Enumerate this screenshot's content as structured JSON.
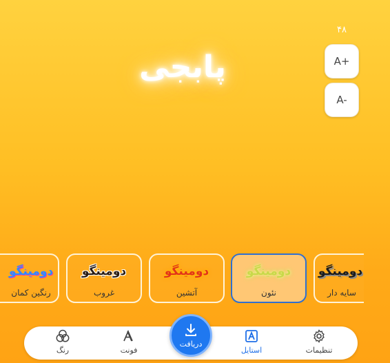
{
  "font_size": {
    "value": "۴۸",
    "increase_label": "A+",
    "decrease_label": "A-"
  },
  "preview": {
    "text": "پابجی"
  },
  "styles": [
    {
      "sample": "دومینگو",
      "label": "سایه دار",
      "selected": false
    },
    {
      "sample": "دومینگو",
      "label": "نئون",
      "selected": true
    },
    {
      "sample": "دومینگو",
      "label": "آتشین",
      "selected": false
    },
    {
      "sample": "دومینگو",
      "label": "غروب",
      "selected": false
    },
    {
      "sample": "دومینگو",
      "label": "رنگین کمان",
      "selected": false
    }
  ],
  "nav": {
    "settings": {
      "label": "تنظیمات",
      "icon": "gear-icon"
    },
    "style": {
      "label": "استایل",
      "icon": "style-icon",
      "active": true
    },
    "download": {
      "label": "دریافت",
      "icon": "download-icon"
    },
    "font": {
      "label": "فونت",
      "icon": "font-icon"
    },
    "color": {
      "label": "رنگ",
      "icon": "color-circles-icon"
    }
  },
  "colors": {
    "accent": "#1f78f0",
    "active_text": "#1e6fe8",
    "background_top": "#ffd23f",
    "background_bottom": "#ffa314"
  }
}
